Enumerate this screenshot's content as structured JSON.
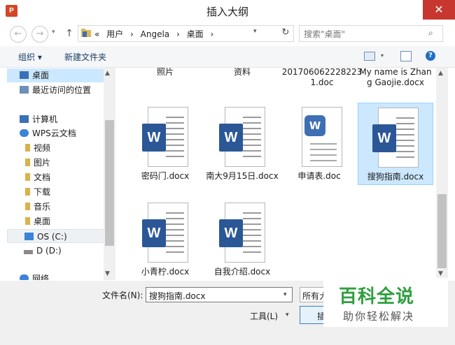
{
  "window": {
    "title": "插入大纲",
    "app_icon": "P"
  },
  "nav_buttons": {
    "back": "←",
    "forward": "→",
    "up": "↑",
    "history": "▾",
    "refresh": "↻"
  },
  "address": {
    "prefix": "«",
    "crumbs": [
      "用户",
      "Angela",
      "桌面"
    ],
    "separator": "›",
    "dropdown": "▾"
  },
  "search": {
    "placeholder": "搜索\"桌面\"",
    "icon": "⌕"
  },
  "toolbar": {
    "organize": "组织 ▾",
    "new_folder": "新建文件夹",
    "view_caret": "▾",
    "help": "?"
  },
  "nav_items": [
    {
      "label": "桌面",
      "icon": "desktop",
      "color": "#3b6fb6"
    },
    {
      "label": "最近访问的位置",
      "icon": "recent",
      "color": "#6d8fb8"
    },
    {
      "label": "计算机",
      "icon": "computer",
      "color": "#3b6fb6"
    },
    {
      "label": "WPS云文档",
      "icon": "cloud",
      "color": "#3b83d8"
    },
    {
      "label": "视频",
      "icon": "folder",
      "color": "#d9b24a"
    },
    {
      "label": "图片",
      "icon": "folder",
      "color": "#d9b24a"
    },
    {
      "label": "文档",
      "icon": "folder",
      "color": "#d9b24a"
    },
    {
      "label": "下载",
      "icon": "folder",
      "color": "#d9b24a"
    },
    {
      "label": "音乐",
      "icon": "folder",
      "color": "#d9b24a"
    },
    {
      "label": "桌面",
      "icon": "folder",
      "color": "#d9b24a"
    },
    {
      "label": "OS (C:)",
      "icon": "drive",
      "color": "#3b83d8"
    },
    {
      "label": "D (D:)",
      "icon": "drive",
      "color": "#8a8a8a"
    },
    {
      "label": "网络",
      "icon": "network",
      "color": "#3b83d8"
    }
  ],
  "top_row_labels": [
    "照片",
    "资料",
    "2017060622282231.doc",
    "My name is Zhang Gaojie.docx"
  ],
  "files": [
    {
      "name": "密码门.docx",
      "kind": "word"
    },
    {
      "name": "南大9月15日.docx",
      "kind": "word"
    },
    {
      "name": "申请表.doc",
      "kind": "wps"
    },
    {
      "name": "搜狗指南.docx",
      "kind": "word",
      "selected": true
    },
    {
      "name": "小青柠.docx",
      "kind": "word"
    },
    {
      "name": "自我介绍.docx",
      "kind": "word"
    }
  ],
  "word_badge": "W",
  "wps_badge": "W",
  "scroll": {
    "up": "▲",
    "down": "▼"
  },
  "bottom": {
    "filename_label": "文件名(N):",
    "filename_value": "搜狗指南.docx",
    "filetype_value": "所有大纲",
    "tools_label": "工具(L)",
    "insert_label": "插入",
    "caret": "▾"
  },
  "watermark": {
    "main": "百科全说",
    "sub": "助你轻松解决"
  },
  "colors": {
    "accent_selection": "#cce8ff",
    "close": "#c7372f",
    "word_blue": "#2b5797",
    "watermark_green": "#2e9f3e"
  }
}
